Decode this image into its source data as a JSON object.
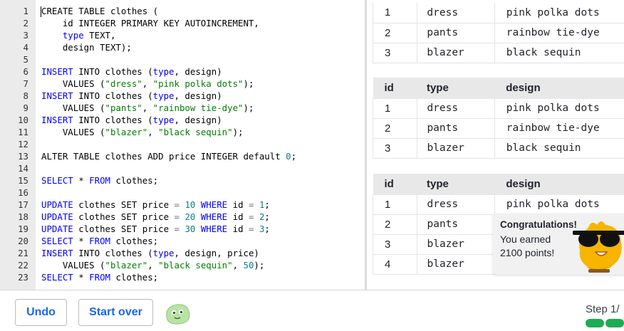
{
  "editor": {
    "lines": [
      {
        "n": "1",
        "tokens": [
          [
            "CREATE TABLE clothes (",
            ""
          ]
        ]
      },
      {
        "n": "2",
        "tokens": [
          [
            "    id INTEGER PRIMARY KEY AUTOINCREMENT,",
            ""
          ]
        ]
      },
      {
        "n": "3",
        "tokens": [
          [
            "    ",
            ""
          ],
          [
            "type",
            "kw"
          ],
          [
            " TEXT,",
            ""
          ]
        ]
      },
      {
        "n": "4",
        "tokens": [
          [
            "    design TEXT);",
            ""
          ]
        ]
      },
      {
        "n": "5",
        "tokens": []
      },
      {
        "n": "6",
        "tokens": [
          [
            "INSERT",
            "kw"
          ],
          [
            " INTO clothes (",
            ""
          ],
          [
            "type",
            "kw"
          ],
          [
            ", design)",
            ""
          ]
        ]
      },
      {
        "n": "7",
        "tokens": [
          [
            "    VALUES (",
            ""
          ],
          [
            "\"dress\"",
            "str"
          ],
          [
            ", ",
            ""
          ],
          [
            "\"pink polka dots\"",
            "str"
          ],
          [
            ");",
            ""
          ]
        ]
      },
      {
        "n": "8",
        "tokens": [
          [
            "INSERT",
            "kw"
          ],
          [
            " INTO clothes (",
            ""
          ],
          [
            "type",
            "kw"
          ],
          [
            ", design)",
            ""
          ]
        ]
      },
      {
        "n": "9",
        "tokens": [
          [
            "    VALUES (",
            ""
          ],
          [
            "\"pants\"",
            "str"
          ],
          [
            ", ",
            ""
          ],
          [
            "\"rainbow tie-dye\"",
            "str"
          ],
          [
            ");",
            ""
          ]
        ]
      },
      {
        "n": "10",
        "tokens": [
          [
            "INSERT",
            "kw"
          ],
          [
            " INTO clothes (",
            ""
          ],
          [
            "type",
            "kw"
          ],
          [
            ", design)",
            ""
          ]
        ]
      },
      {
        "n": "11",
        "tokens": [
          [
            "    VALUES (",
            ""
          ],
          [
            "\"blazer\"",
            "str"
          ],
          [
            ", ",
            ""
          ],
          [
            "\"black sequin\"",
            "str"
          ],
          [
            ");",
            ""
          ]
        ]
      },
      {
        "n": "12",
        "tokens": []
      },
      {
        "n": "13",
        "tokens": [
          [
            "ALTER TABLE clothes ADD price INTEGER default ",
            ""
          ],
          [
            "0",
            "num"
          ],
          [
            ";",
            ""
          ]
        ]
      },
      {
        "n": "14",
        "tokens": []
      },
      {
        "n": "15",
        "tokens": [
          [
            "SELECT",
            "kw"
          ],
          [
            " * ",
            ""
          ],
          [
            "FROM",
            "kw"
          ],
          [
            " clothes;",
            ""
          ]
        ]
      },
      {
        "n": "16",
        "tokens": []
      },
      {
        "n": "17",
        "tokens": [
          [
            "UPDATE",
            "kw"
          ],
          [
            " clothes SET price ",
            ""
          ],
          [
            "=",
            "op"
          ],
          [
            " ",
            ""
          ],
          [
            "10",
            "num"
          ],
          [
            " ",
            ""
          ],
          [
            "WHERE",
            "kw"
          ],
          [
            " id ",
            ""
          ],
          [
            "=",
            "op"
          ],
          [
            " ",
            ""
          ],
          [
            "1",
            "num"
          ],
          [
            ";",
            ""
          ]
        ]
      },
      {
        "n": "18",
        "tokens": [
          [
            "UPDATE",
            "kw"
          ],
          [
            " clothes SET price ",
            ""
          ],
          [
            "=",
            "op"
          ],
          [
            " ",
            ""
          ],
          [
            "20",
            "num"
          ],
          [
            " ",
            ""
          ],
          [
            "WHERE",
            "kw"
          ],
          [
            " id ",
            ""
          ],
          [
            "=",
            "op"
          ],
          [
            " ",
            ""
          ],
          [
            "2",
            "num"
          ],
          [
            ";",
            ""
          ]
        ]
      },
      {
        "n": "19",
        "tokens": [
          [
            "UPDATE",
            "kw"
          ],
          [
            " clothes SET price ",
            ""
          ],
          [
            "=",
            "op"
          ],
          [
            " ",
            ""
          ],
          [
            "30",
            "num"
          ],
          [
            " ",
            ""
          ],
          [
            "WHERE",
            "kw"
          ],
          [
            " id ",
            ""
          ],
          [
            "=",
            "op"
          ],
          [
            " ",
            ""
          ],
          [
            "3",
            "num"
          ],
          [
            ";",
            ""
          ]
        ]
      },
      {
        "n": "20",
        "tokens": [
          [
            "SELECT",
            "kw"
          ],
          [
            " * ",
            ""
          ],
          [
            "FROM",
            "kw"
          ],
          [
            " clothes;",
            ""
          ]
        ]
      },
      {
        "n": "21",
        "tokens": [
          [
            "INSERT",
            "kw"
          ],
          [
            " INTO clothes (",
            ""
          ],
          [
            "type",
            "kw"
          ],
          [
            ", design, price)",
            ""
          ]
        ]
      },
      {
        "n": "22",
        "tokens": [
          [
            "    VALUES (",
            ""
          ],
          [
            "\"blazer\"",
            "str"
          ],
          [
            ", ",
            ""
          ],
          [
            "\"black sequin\"",
            "str"
          ],
          [
            ", ",
            ""
          ],
          [
            "50",
            "num"
          ],
          [
            ");",
            ""
          ]
        ]
      },
      {
        "n": "23",
        "tokens": [
          [
            "SELECT",
            "kw"
          ],
          [
            " * ",
            ""
          ],
          [
            "FROM",
            "kw"
          ],
          [
            " clothes;",
            ""
          ]
        ]
      }
    ]
  },
  "results": {
    "table1": {
      "rows": [
        [
          "1",
          "dress",
          "pink polka dots"
        ],
        [
          "2",
          "pants",
          "rainbow tie-dye"
        ],
        [
          "3",
          "blazer",
          "black sequin"
        ]
      ]
    },
    "table2": {
      "headers": [
        "id",
        "type",
        "design"
      ],
      "rows": [
        [
          "1",
          "dress",
          "pink polka dots"
        ],
        [
          "2",
          "pants",
          "rainbow tie-dye"
        ],
        [
          "3",
          "blazer",
          "black sequin"
        ]
      ]
    },
    "table3": {
      "headers": [
        "id",
        "type",
        "design"
      ],
      "rows": [
        [
          "1",
          "dress",
          "pink polka dots"
        ],
        [
          "2",
          "pants",
          ""
        ],
        [
          "3",
          "blazer",
          ""
        ],
        [
          "4",
          "blazer",
          ""
        ]
      ]
    }
  },
  "toast": {
    "title": "Congratulations!",
    "body": "You earned 2100 points!"
  },
  "footer": {
    "undo_label": "Undo",
    "start_over_label": "Start over",
    "step_label": "Step 1/",
    "progress_segments": 3
  },
  "colors": {
    "keyword": "#0000ff",
    "string": "#008000",
    "number": "#0a7f8f",
    "button_text": "#1865f2",
    "progress": "#1fab54"
  },
  "icons": {
    "mascot": "cool-orange-mascot-icon",
    "blob": "green-blob-avatar-icon"
  }
}
